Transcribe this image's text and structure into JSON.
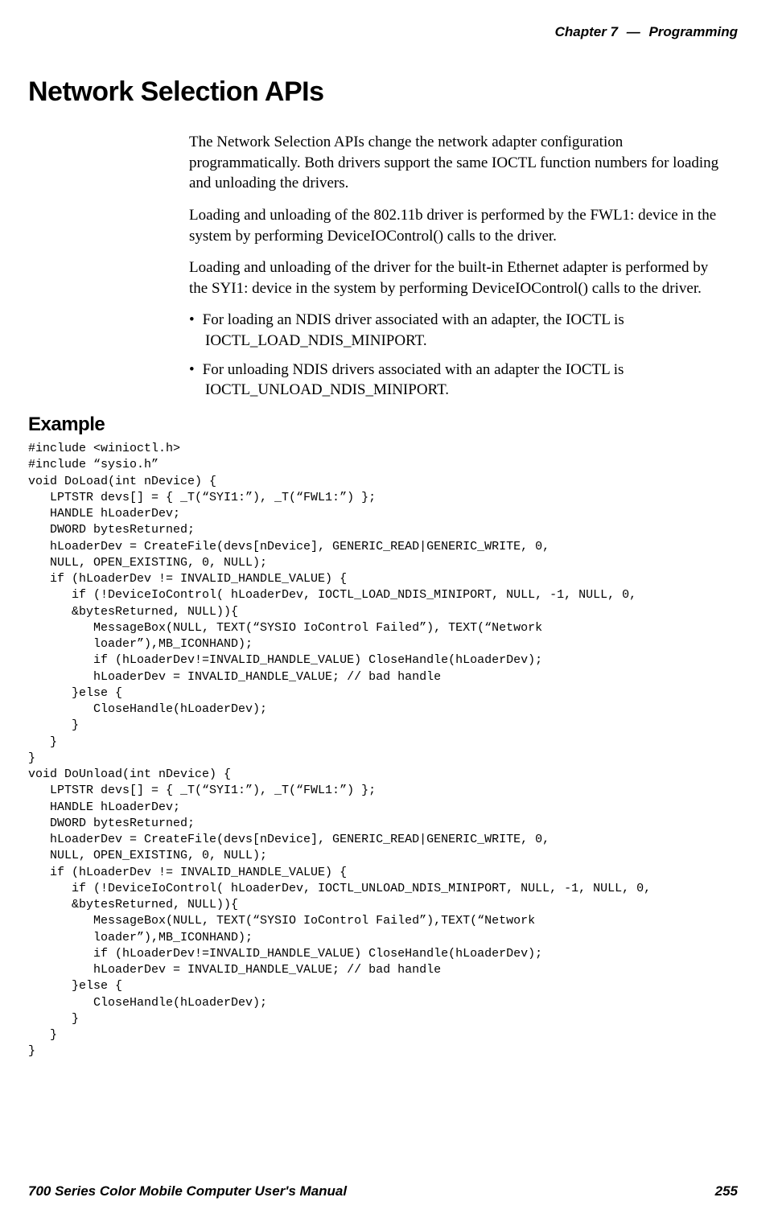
{
  "header": {
    "chapter": "Chapter 7",
    "separator": "—",
    "topic": "Programming"
  },
  "title": "Network Selection APIs",
  "paragraphs": {
    "p1": "The Network Selection APIs change the network adapter configuration programmatically. Both drivers support the same IOCTL function numbers for loading and unloading the drivers.",
    "p2": "Loading and unloading of the 802.11b driver is performed by the FWL1: device in the system by performing DeviceIOControl() calls to the driver.",
    "p3": "Loading and unloading of the driver for the built-in Ethernet adapter is performed by the SYI1: device in the system by performing DeviceIOControl() calls to the driver."
  },
  "bullets": {
    "b1": "For loading an NDIS driver associated with an adapter, the IOCTL is IOCTL_LOAD_NDIS_MINIPORT.",
    "b2": "For unloading NDIS drivers associated with an adapter the IOCTL is IOCTL_UNLOAD_NDIS_MINIPORT."
  },
  "subheading": "Example",
  "code": "#include <winioctl.h>\n#include “sysio.h”\nvoid DoLoad(int nDevice) {\n   LPTSTR devs[] = { _T(“SYI1:”), _T(“FWL1:”) };\n   HANDLE hLoaderDev;\n   DWORD bytesReturned;\n   hLoaderDev = CreateFile(devs[nDevice], GENERIC_READ|GENERIC_WRITE, 0,\n   NULL, OPEN_EXISTING, 0, NULL);\n   if (hLoaderDev != INVALID_HANDLE_VALUE) {\n      if (!DeviceIoControl( hLoaderDev, IOCTL_LOAD_NDIS_MINIPORT, NULL, -1, NULL, 0,\n      &bytesReturned, NULL)){\n         MessageBox(NULL, TEXT(“SYSIO IoControl Failed”), TEXT(“Network\n         loader”),MB_ICONHAND);\n         if (hLoaderDev!=INVALID_HANDLE_VALUE) CloseHandle(hLoaderDev);\n         hLoaderDev = INVALID_HANDLE_VALUE; // bad handle\n      }else {\n         CloseHandle(hLoaderDev);\n      }\n   }\n}\nvoid DoUnload(int nDevice) {\n   LPTSTR devs[] = { _T(“SYI1:”), _T(“FWL1:”) };\n   HANDLE hLoaderDev;\n   DWORD bytesReturned;\n   hLoaderDev = CreateFile(devs[nDevice], GENERIC_READ|GENERIC_WRITE, 0,\n   NULL, OPEN_EXISTING, 0, NULL);\n   if (hLoaderDev != INVALID_HANDLE_VALUE) {\n      if (!DeviceIoControl( hLoaderDev, IOCTL_UNLOAD_NDIS_MINIPORT, NULL, -1, NULL, 0,\n      &bytesReturned, NULL)){\n         MessageBox(NULL, TEXT(“SYSIO IoControl Failed”),TEXT(“Network\n         loader”),MB_ICONHAND);\n         if (hLoaderDev!=INVALID_HANDLE_VALUE) CloseHandle(hLoaderDev);\n         hLoaderDev = INVALID_HANDLE_VALUE; // bad handle\n      }else {\n         CloseHandle(hLoaderDev);\n      }\n   }\n}",
  "footer": {
    "manual": "700 Series Color Mobile Computer User's Manual",
    "page": "255"
  }
}
